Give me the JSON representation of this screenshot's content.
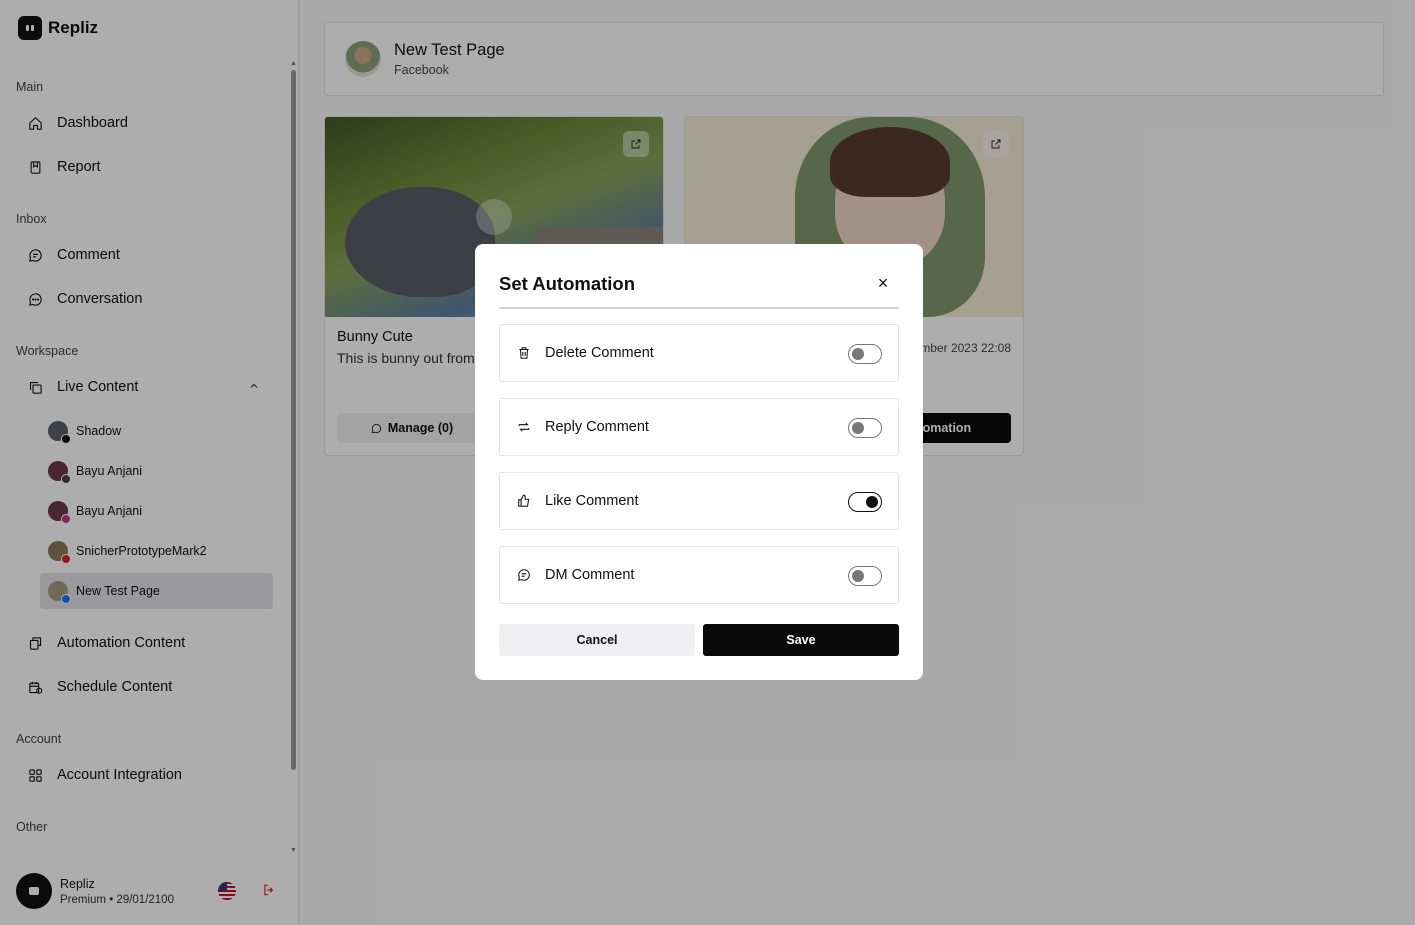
{
  "brand": {
    "name": "Repliz"
  },
  "sidebar": {
    "sections": {
      "main": "Main",
      "inbox": "Inbox",
      "workspace": "Workspace",
      "account": "Account",
      "other": "Other"
    },
    "items": {
      "dashboard": "Dashboard",
      "report": "Report",
      "comment": "Comment",
      "conversation": "Conversation",
      "live_content": "Live Content",
      "automation_content": "Automation Content",
      "schedule_content": "Schedule Content",
      "account_integration": "Account Integration"
    },
    "live_accounts": [
      {
        "name": "Shadow",
        "platform": "tiktok",
        "color": "#111111"
      },
      {
        "name": "Bayu Anjani",
        "platform": "threads",
        "color": "#444444"
      },
      {
        "name": "Bayu Anjani",
        "platform": "instagram",
        "color": "#c13584"
      },
      {
        "name": "SnicherPrototypeMark2",
        "platform": "youtube",
        "color": "#e02020"
      },
      {
        "name": "New Test Page",
        "platform": "facebook",
        "color": "#1877f2"
      }
    ]
  },
  "user": {
    "name": "Repliz",
    "plan": "Premium • 29/01/2100"
  },
  "page": {
    "title": "New Test Page",
    "platform": "Facebook"
  },
  "cards": [
    {
      "title": "Bunny Cute",
      "description": "This is bunny out from",
      "manage_label": "Manage (0)"
    },
    {
      "date": "mber 2023 22:08",
      "automation_label": "utomation"
    }
  ],
  "modal": {
    "title": "Set Automation",
    "close": "×",
    "options": [
      {
        "label": "Delete Comment",
        "icon": "trash-icon",
        "enabled": false
      },
      {
        "label": "Reply Comment",
        "icon": "repeat-icon",
        "enabled": false
      },
      {
        "label": "Like Comment",
        "icon": "thumbs-up-icon",
        "enabled": true
      },
      {
        "label": "DM Comment",
        "icon": "message-icon",
        "enabled": false
      }
    ],
    "cancel": "Cancel",
    "save": "Save"
  }
}
